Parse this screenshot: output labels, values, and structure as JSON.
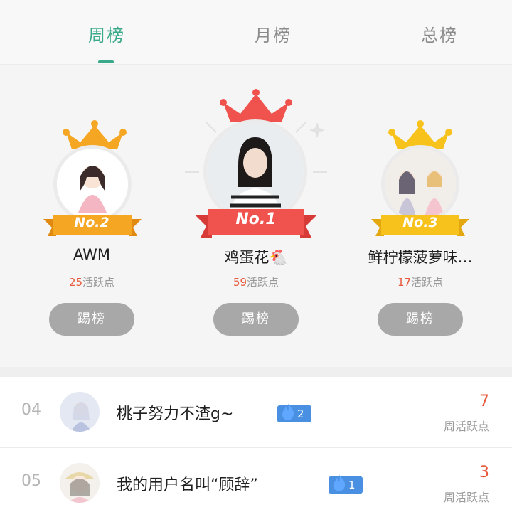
{
  "tabs": [
    {
      "label": "周榜",
      "active": true
    },
    {
      "label": "月榜",
      "active": false
    },
    {
      "label": "总榜",
      "active": false
    }
  ],
  "podium": [
    {
      "rank_label": "No.2",
      "name": "AWM",
      "points": "25",
      "points_label": "活跃点",
      "button": "踢榜",
      "color": "#f5a623"
    },
    {
      "rank_label": "No.1",
      "name": "鸡蛋花🐔",
      "points": "59",
      "points_label": "活跃点",
      "button": "踢榜",
      "color": "#f0524d"
    },
    {
      "rank_label": "No.3",
      "name": "鲜柠檬菠萝味…",
      "points": "17",
      "points_label": "活跃点",
      "button": "踢榜",
      "color": "#f7c21c"
    }
  ],
  "list": [
    {
      "rank": "04",
      "name": "桃子努力不渣g~",
      "badge": "2",
      "points": "7",
      "points_label": "周活跃点"
    },
    {
      "rank": "05",
      "name": "我的用户名叫“顾辞”",
      "badge": "1",
      "points": "3",
      "points_label": "周活跃点"
    }
  ],
  "colors": {
    "accent": "#3aa98a",
    "points": "#e8583a",
    "badge": "#4a90e2"
  }
}
